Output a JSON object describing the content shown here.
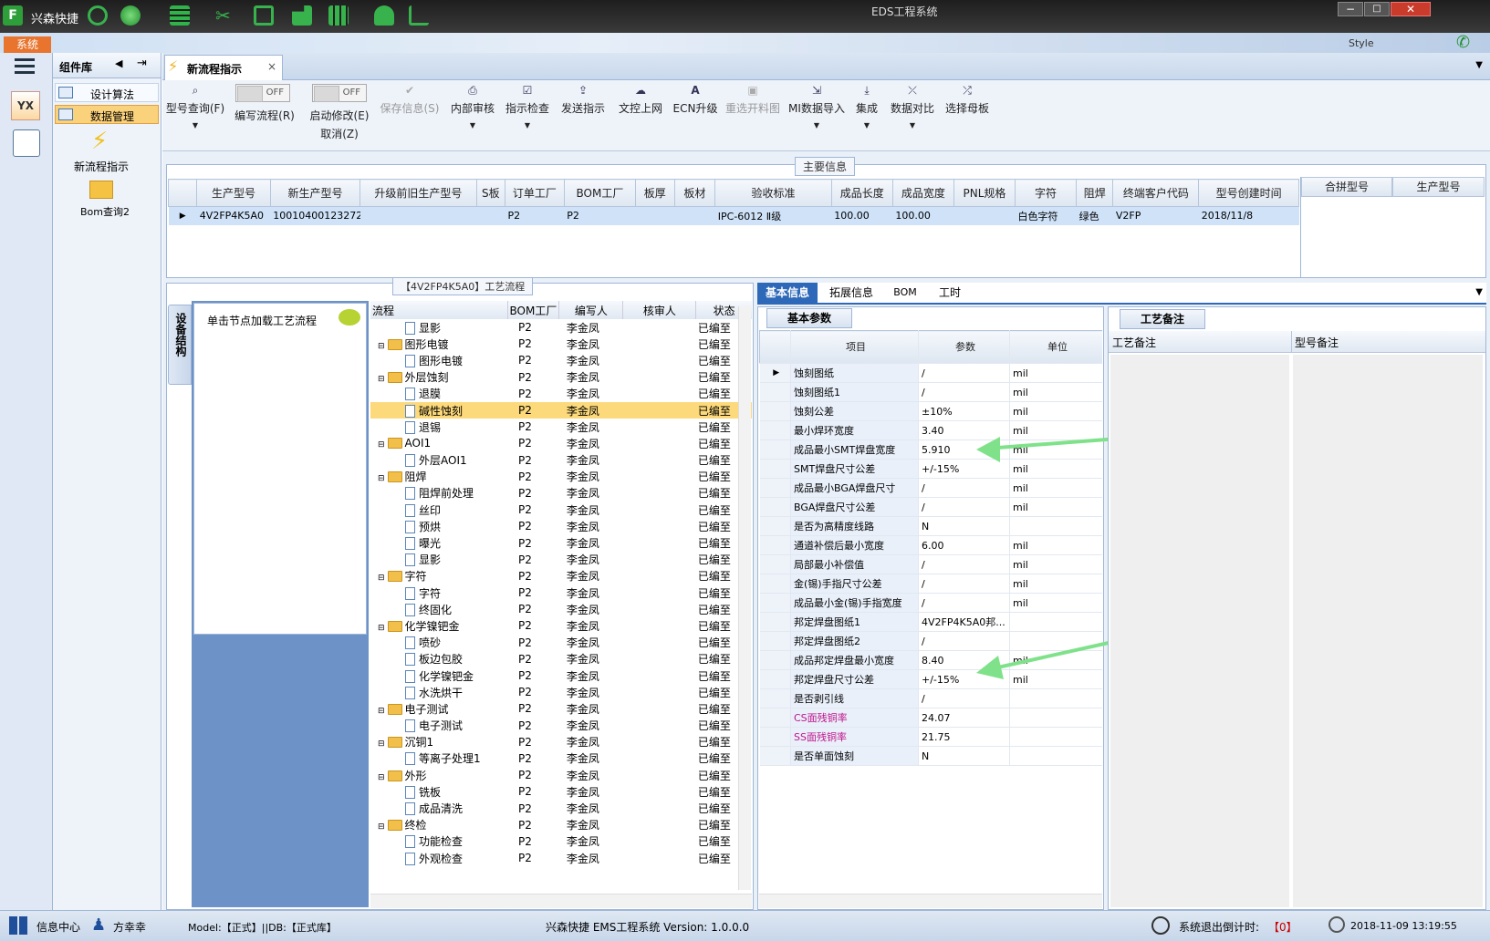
{
  "app": {
    "name": "兴森快捷",
    "window_title": "EDS工程系统",
    "menu_label": "系统",
    "style_label": "Style"
  },
  "sidebar": {
    "header": "组件库",
    "items": [
      {
        "label": "设计算法"
      },
      {
        "label": "数据管理"
      }
    ],
    "icons": [
      {
        "label": "新流程指示"
      },
      {
        "label": "Bom查询2"
      }
    ]
  },
  "doc_tab": {
    "label": "新流程指示"
  },
  "toolbar": {
    "buttons": [
      {
        "label": "型号查询(F)",
        "icon": "search-icon"
      },
      {
        "label": "编写流程(R)",
        "toggle": "OFF"
      },
      {
        "label": "启动修改(E)",
        "sub": "取消(Z)",
        "toggle": "OFF"
      },
      {
        "label": "保存信息(S)",
        "icon": "check-icon",
        "disabled": true
      },
      {
        "label": "内部审核",
        "icon": "print-icon"
      },
      {
        "label": "指示检查",
        "icon": "check-icon"
      },
      {
        "label": "发送指示",
        "icon": "upload-icon"
      },
      {
        "label": "文控上网",
        "icon": "cloud-icon"
      },
      {
        "label": "ECN升级",
        "icon": "font-icon"
      },
      {
        "label": "重选开料图",
        "icon": "image-icon",
        "disabled": true
      },
      {
        "label": "MI数据导入",
        "icon": "import-icon"
      },
      {
        "label": "集成",
        "icon": "download-icon"
      },
      {
        "label": "数据对比",
        "icon": "compare-icon"
      },
      {
        "label": "选择母板",
        "icon": "shuffle-icon"
      }
    ]
  },
  "main_info": {
    "title": "主要信息",
    "columns": [
      "生产型号",
      "新生产型号",
      "升级前旧生产型号",
      "S板",
      "订单工厂",
      "BOM工厂",
      "板厚",
      "板材",
      "验收标准",
      "成品长度",
      "成品宽度",
      "PNL规格",
      "字符",
      "阻焊",
      "终端客户代码",
      "型号创建时间"
    ],
    "row": [
      "4V2FP4K5A0",
      "10010400123272",
      "",
      "",
      "P2",
      "P2",
      "",
      "",
      "IPC-6012 Ⅱ级",
      "100.00",
      "100.00",
      "",
      "白色字符",
      "绿色",
      "V2FP",
      "2018/11/8"
    ],
    "side_columns": [
      "合拼型号",
      "生产型号"
    ]
  },
  "process": {
    "title": "【4V2FP4K5A0】工艺流程",
    "vertical_tab": "设备结构",
    "hint": "单击节点加载工艺流程",
    "columns": [
      "流程",
      "BOM工厂",
      "编写人",
      "核审人",
      "状态"
    ],
    "rows": [
      {
        "name": "显影",
        "level": 2,
        "bom": "P2",
        "author": "李金凤",
        "status": "已编至"
      },
      {
        "name": "图形电镀",
        "level": 1,
        "bom": "P2",
        "author": "李金凤",
        "status": "已编至"
      },
      {
        "name": "图形电镀",
        "level": 2,
        "bom": "P2",
        "author": "李金凤",
        "status": "已编至"
      },
      {
        "name": "外层蚀刻",
        "level": 1,
        "bom": "P2",
        "author": "李金凤",
        "status": "已编至"
      },
      {
        "name": "退膜",
        "level": 2,
        "bom": "P2",
        "author": "李金凤",
        "status": "已编至"
      },
      {
        "name": "碱性蚀刻",
        "level": 2,
        "bom": "P2",
        "author": "李金凤",
        "status": "已编至",
        "selected": true
      },
      {
        "name": "退锡",
        "level": 2,
        "bom": "P2",
        "author": "李金凤",
        "status": "已编至"
      },
      {
        "name": "AOI1",
        "level": 1,
        "bom": "P2",
        "author": "李金凤",
        "status": "已编至"
      },
      {
        "name": "外层AOI1",
        "level": 2,
        "bom": "P2",
        "author": "李金凤",
        "status": "已编至"
      },
      {
        "name": "阻焊",
        "level": 1,
        "bom": "P2",
        "author": "李金凤",
        "status": "已编至"
      },
      {
        "name": "阻焊前处理",
        "level": 2,
        "bom": "P2",
        "author": "李金凤",
        "status": "已编至"
      },
      {
        "name": "丝印",
        "level": 2,
        "bom": "P2",
        "author": "李金凤",
        "status": "已编至"
      },
      {
        "name": "预烘",
        "level": 2,
        "bom": "P2",
        "author": "李金凤",
        "status": "已编至"
      },
      {
        "name": "曝光",
        "level": 2,
        "bom": "P2",
        "author": "李金凤",
        "status": "已编至"
      },
      {
        "name": "显影",
        "level": 2,
        "bom": "P2",
        "author": "李金凤",
        "status": "已编至"
      },
      {
        "name": "字符",
        "level": 1,
        "bom": "P2",
        "author": "李金凤",
        "status": "已编至"
      },
      {
        "name": "字符",
        "level": 2,
        "bom": "P2",
        "author": "李金凤",
        "status": "已编至"
      },
      {
        "name": "终固化",
        "level": 2,
        "bom": "P2",
        "author": "李金凤",
        "status": "已编至"
      },
      {
        "name": "化学镍钯金",
        "level": 1,
        "bom": "P2",
        "author": "李金凤",
        "status": "已编至"
      },
      {
        "name": "喷砂",
        "level": 2,
        "bom": "P2",
        "author": "李金凤",
        "status": "已编至"
      },
      {
        "name": "板边包胶",
        "level": 2,
        "bom": "P2",
        "author": "李金凤",
        "status": "已编至"
      },
      {
        "name": "化学镍钯金",
        "level": 2,
        "bom": "P2",
        "author": "李金凤",
        "status": "已编至"
      },
      {
        "name": "水洗烘干",
        "level": 2,
        "bom": "P2",
        "author": "李金凤",
        "status": "已编至"
      },
      {
        "name": "电子测试",
        "level": 1,
        "bom": "P2",
        "author": "李金凤",
        "status": "已编至"
      },
      {
        "name": "电子测试",
        "level": 2,
        "bom": "P2",
        "author": "李金凤",
        "status": "已编至"
      },
      {
        "name": "沉铜1",
        "level": 1,
        "bom": "P2",
        "author": "李金凤",
        "status": "已编至"
      },
      {
        "name": "等离子处理1",
        "level": 2,
        "bom": "P2",
        "author": "李金凤",
        "status": "已编至"
      },
      {
        "name": "外形",
        "level": 1,
        "bom": "P2",
        "author": "李金凤",
        "status": "已编至"
      },
      {
        "name": "铣板",
        "level": 2,
        "bom": "P2",
        "author": "李金凤",
        "status": "已编至"
      },
      {
        "name": "成品清洗",
        "level": 2,
        "bom": "P2",
        "author": "李金凤",
        "status": "已编至"
      },
      {
        "name": "终检",
        "level": 1,
        "bom": "P2",
        "author": "李金凤",
        "status": "已编至"
      },
      {
        "name": "功能检查",
        "level": 2,
        "bom": "P2",
        "author": "李金凤",
        "status": "已编至"
      },
      {
        "name": "外观检查",
        "level": 2,
        "bom": "P2",
        "author": "李金凤",
        "status": "已编至"
      }
    ]
  },
  "info_tabs": [
    "基本信息",
    "拓展信息",
    "BOM",
    "工时"
  ],
  "basic_params": {
    "title": "基本参数",
    "columns": [
      "项目",
      "参数",
      "单位"
    ],
    "rows": [
      {
        "item": "蚀刻图纸",
        "value": "/",
        "unit": "mil"
      },
      {
        "item": "蚀刻图纸1",
        "value": "/",
        "unit": "mil"
      },
      {
        "item": "蚀刻公差",
        "value": "±10%",
        "unit": "mil"
      },
      {
        "item": "最小焊环宽度",
        "value": "3.40",
        "unit": "mil"
      },
      {
        "item": "成品最小SMT焊盘宽度",
        "value": "5.910",
        "unit": "mil"
      },
      {
        "item": "SMT焊盘尺寸公差",
        "value": "+/-15%",
        "unit": "mil"
      },
      {
        "item": "成品最小BGA焊盘尺寸",
        "value": "/",
        "unit": "mil"
      },
      {
        "item": "BGA焊盘尺寸公差",
        "value": "/",
        "unit": "mil"
      },
      {
        "item": "是否为高精度线路",
        "value": "N",
        "unit": ""
      },
      {
        "item": "通道补偿后最小宽度",
        "value": "6.00",
        "unit": "mil"
      },
      {
        "item": "局部最小补偿值",
        "value": "/",
        "unit": "mil"
      },
      {
        "item": "金(锡)手指尺寸公差",
        "value": "/",
        "unit": "mil"
      },
      {
        "item": "成品最小金(锡)手指宽度",
        "value": "/",
        "unit": "mil"
      },
      {
        "item": "邦定焊盘图纸1",
        "value": "4V2FP4K5A0邦...",
        "unit": ""
      },
      {
        "item": "邦定焊盘图纸2",
        "value": "/",
        "unit": ""
      },
      {
        "item": "成品邦定焊盘最小宽度",
        "value": "8.40",
        "unit": "mil"
      },
      {
        "item": "邦定焊盘尺寸公差",
        "value": "+/-15%",
        "unit": "mil"
      },
      {
        "item": "是否剥引线",
        "value": "/",
        "unit": ""
      },
      {
        "item": "CS面残铜率",
        "value": "24.07",
        "unit": "",
        "highlight": true
      },
      {
        "item": "SS面残铜率",
        "value": "21.75",
        "unit": "",
        "highlight": true
      },
      {
        "item": "是否单面蚀刻",
        "value": "N",
        "unit": ""
      }
    ]
  },
  "craft_notes": {
    "title": "工艺备注",
    "columns": [
      "工艺备注",
      "型号备注"
    ]
  },
  "status": {
    "info_center": "信息中心",
    "user": "方幸幸",
    "model": "Model:【正式】||DB:【正式库】",
    "system": "兴森快捷 EMS工程系统 Version: 1.0.0.0",
    "exit_label": "系统退出倒计时:",
    "exit_value": "【0】",
    "clock": "2018-11-09 13:19:55"
  }
}
